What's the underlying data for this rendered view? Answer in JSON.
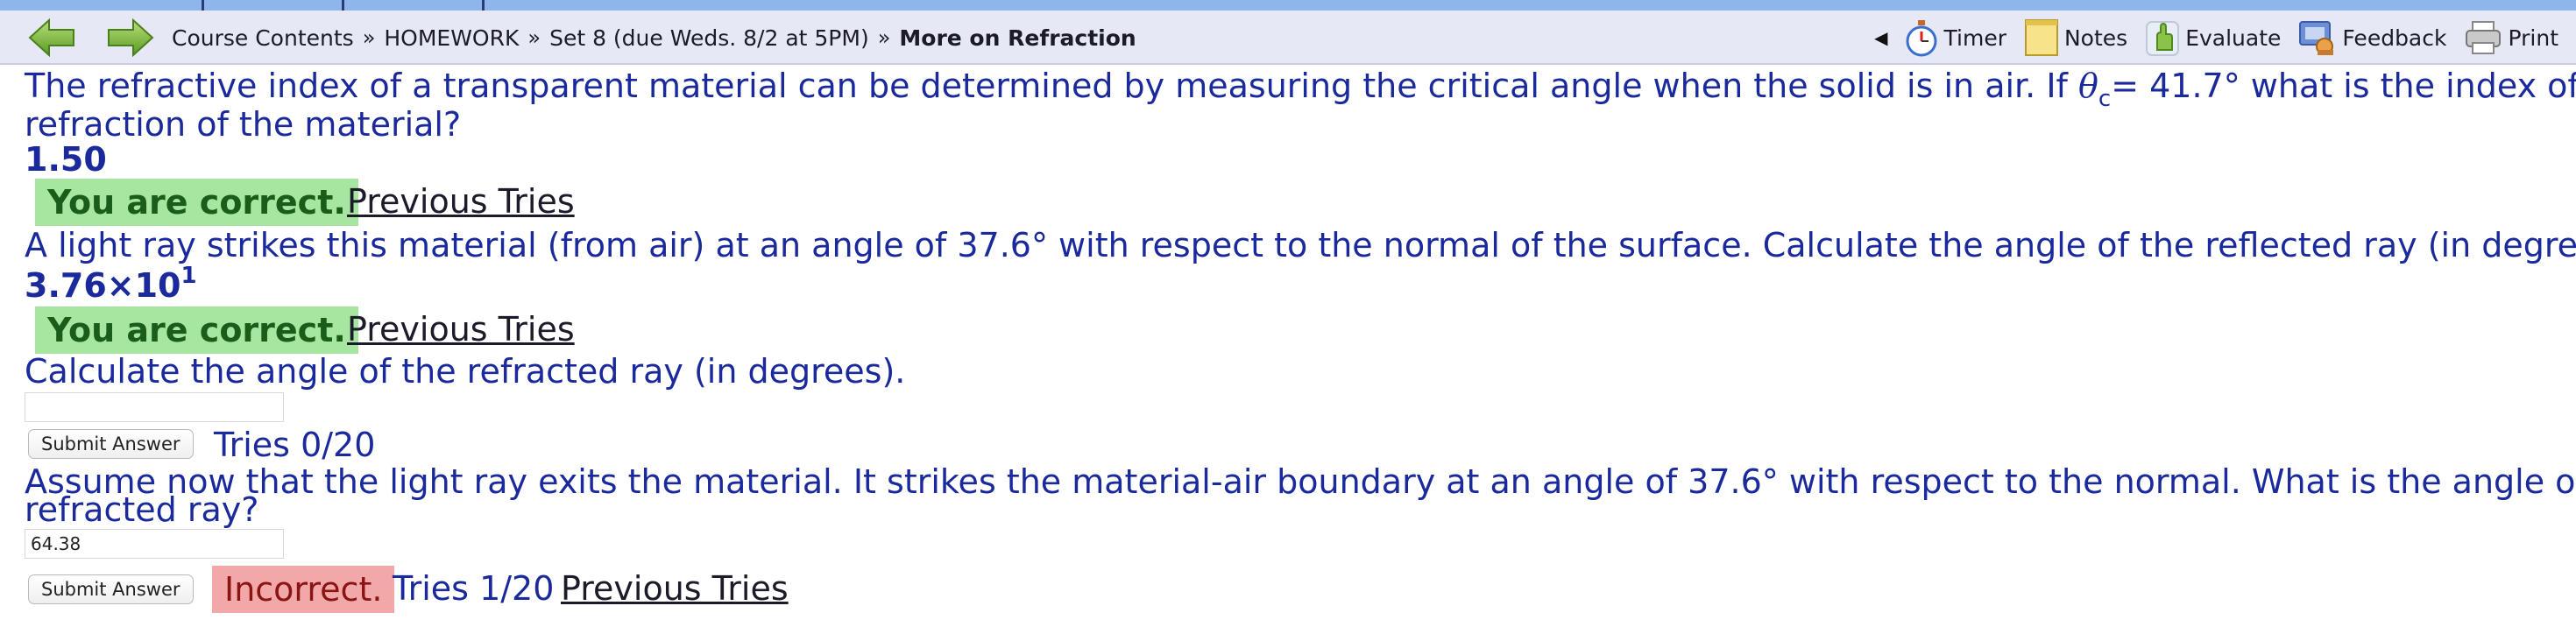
{
  "nav": {
    "back_icon": "green-left-arrow-icon",
    "forward_icon": "green-right-arrow-icon",
    "breadcrumbs": [
      "Course Contents",
      "HOMEWORK",
      "Set 8 (due Weds. 8/2 at 5PM)"
    ],
    "separator": "»",
    "current": "More on Refraction",
    "collapse_glyph": "◀",
    "tools": [
      {
        "label": "Timer",
        "icon": "stopwatch-icon"
      },
      {
        "label": "Notes",
        "icon": "notepad-icon"
      },
      {
        "label": "Evaluate",
        "icon": "evaluate-hand-icon"
      },
      {
        "label": "Feedback",
        "icon": "feedback-icon"
      },
      {
        "label": "Print",
        "icon": "printer-icon"
      }
    ]
  },
  "colors": {
    "accent_text": "#1a2a9c",
    "correct_bg": "#a7e6a0",
    "incorrect_bg": "#f2a8a8",
    "nav_bg": "#e6e8f6"
  },
  "problem": {
    "q1": {
      "text_a": "The refractive index of a transparent material can be determined by measuring the critical angle when the solid is in air. If ",
      "theta": "θ",
      "theta_sub": "c",
      "text_b": "= 41.7° what is the index of",
      "text_c": "refraction of the material?",
      "answer": "1.50",
      "status": "You are correct.",
      "prev": "Previous Tries"
    },
    "q2": {
      "text": "A light ray strikes this material (from air) at an angle of 37.6° with respect to the normal of the surface. Calculate the angle of the reflected ray (in degrees).",
      "answer_mantissa": "3.76×10",
      "answer_exp": "1",
      "status": "You are correct.",
      "prev": "Previous Tries"
    },
    "q3": {
      "text": "Calculate the angle of the refracted ray (in degrees).",
      "input_value": "",
      "submit": "Submit Answer",
      "tries": "Tries 0/20"
    },
    "q4": {
      "text_a": "Assume now that the light ray exits the material. It strikes the material-air boundary at an angle of 37.6° with respect to the normal. What is the angle of the",
      "text_b": "refracted ray?",
      "input_value": "64.38",
      "submit": "Submit Answer",
      "status": "Incorrect.",
      "tries": "Tries 1/20",
      "prev": "Previous Tries"
    }
  }
}
